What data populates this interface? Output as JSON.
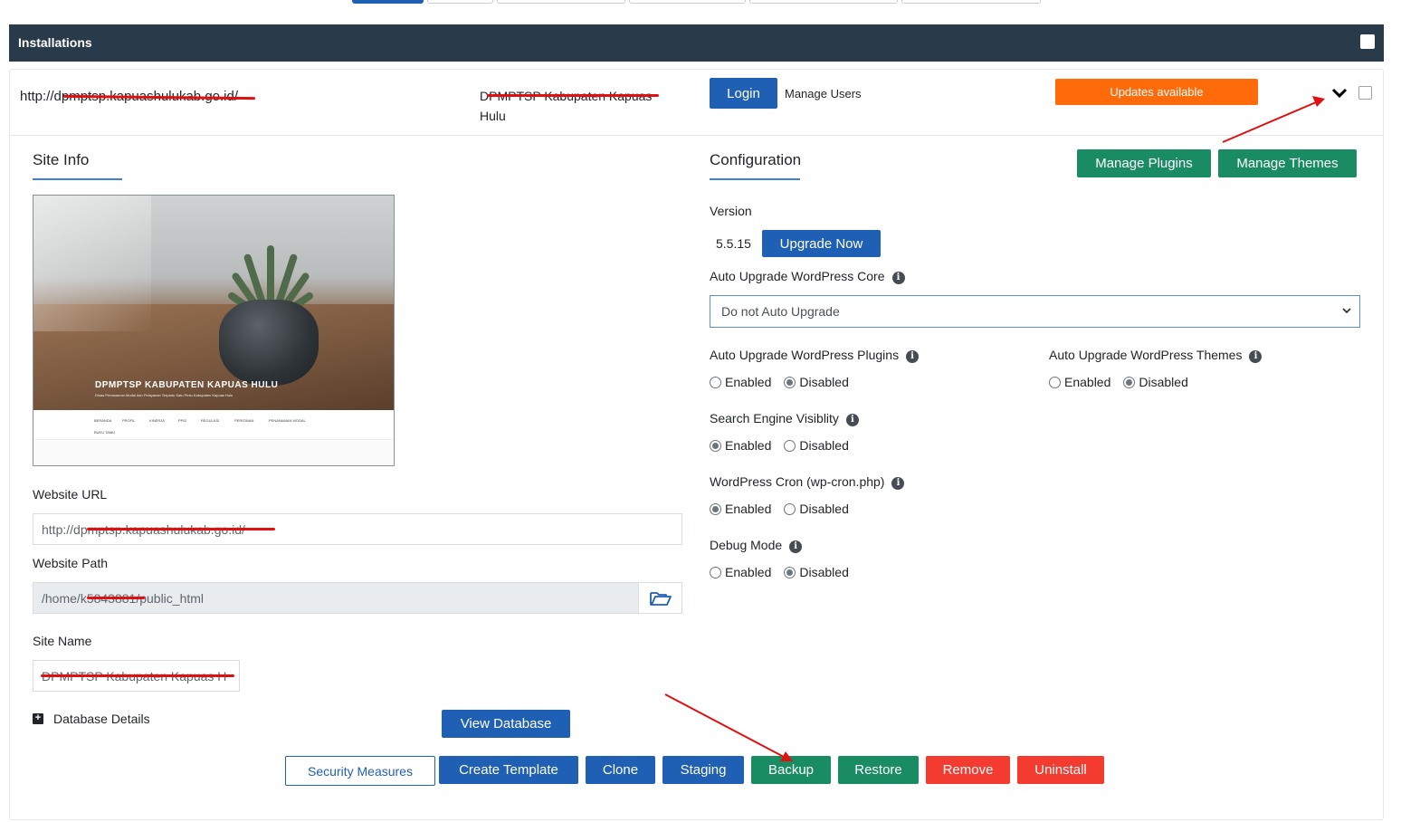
{
  "header": {
    "title": "Installations"
  },
  "installation": {
    "url": "http://dpmptsp.kapuashulukab.go.id/",
    "url_prefix": "http://d",
    "url_redacted": "pmptsp.kapuashulukab.go.id",
    "url_suffix": "/",
    "site_title_line1": "DPMPTSP Kabupaten Kapuas",
    "site_title_line2": "Hulu",
    "login_label": "Login",
    "manage_users_label": "Manage Users",
    "updates_label": "Updates available"
  },
  "site_info": {
    "title": "Site Info",
    "thumbnail": {
      "heading": "DPMPTSP KABUPATEN KAPUAS HULU",
      "subheading": "Dinas Penanaman Modal dan Pelayanan Terpadu Satu Pintu Kabupaten Kapuas Hulu",
      "nav": [
        "BERANDA",
        "PROFIL",
        "KINERJA",
        "PPID",
        "REGULASI",
        "PERIZINAN",
        "PENANAMAN MODAL"
      ],
      "nav_second": "BUKU TAMU"
    },
    "website_url_label": "Website URL",
    "website_url_prefix": "http://d",
    "website_url_redacted": "pmptsp.kapuashulukab.go.id",
    "website_url_suffix": "/",
    "website_path_label": "Website Path",
    "website_path_prefix": "/home/",
    "website_path_redacted": "k5843881",
    "website_path_suffix": "/public_html",
    "site_name_label": "Site Name",
    "site_name_redacted": "DPMPTSP Kabupaten Kapuas H",
    "database_details_label": "Database Details",
    "view_database_label": "View Database"
  },
  "configuration": {
    "title": "Configuration",
    "manage_plugins_label": "Manage Plugins",
    "manage_themes_label": "Manage Themes",
    "version_label": "Version",
    "version_value": "5.5.15",
    "upgrade_now_label": "Upgrade Now",
    "auto_upgrade_core_label": "Auto Upgrade WordPress Core",
    "auto_upgrade_core_value": "Do not Auto Upgrade",
    "auto_upgrade_plugins_label": "Auto Upgrade WordPress Plugins",
    "auto_upgrade_themes_label": "Auto Upgrade WordPress Themes",
    "search_engine_label": "Search Engine Visiblity",
    "cron_label": "WordPress Cron (wp-cron.php)",
    "debug_label": "Debug Mode",
    "enabled_label": "Enabled",
    "disabled_label": "Disabled",
    "states": {
      "plugins": "Disabled",
      "themes": "Disabled",
      "search_engine": "Enabled",
      "cron": "Enabled",
      "debug": "Disabled"
    }
  },
  "actions": {
    "security": "Security Measures",
    "create_template": "Create Template",
    "clone": "Clone",
    "staging": "Staging",
    "backup": "Backup",
    "restore": "Restore",
    "remove": "Remove",
    "uninstall": "Uninstall"
  },
  "colors": {
    "header_bg": "#293a4a",
    "primary_blue": "#1f5fb4",
    "green": "#1a8c63",
    "red": "#f43b2f",
    "orange": "#ff6a0a",
    "annotation_red": "#e01010"
  }
}
